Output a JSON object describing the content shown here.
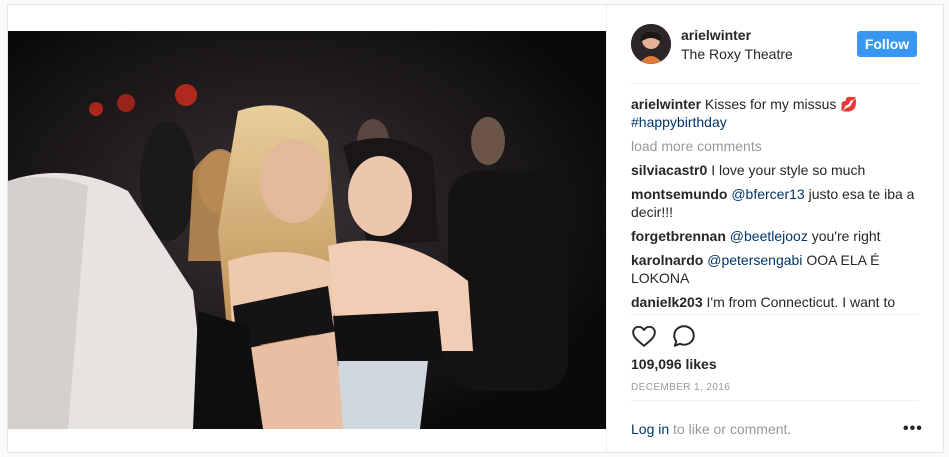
{
  "post": {
    "username": "arielwinter",
    "location": "The Roxy Theatre",
    "follow_label": "Follow",
    "caption_user": "arielwinter",
    "caption_text": "Kisses for my missus 💋",
    "caption_hashtag": "#happybirthday",
    "load_more": "load more comments",
    "comments": [
      {
        "user": "silviacastr0",
        "mention": "",
        "text": "I love your style so much"
      },
      {
        "user": "montsemundo",
        "mention": "@bfercer13",
        "text": "justo esa te iba a decir!!!"
      },
      {
        "user": "forgetbrennan",
        "mention": "@beetlejooz",
        "text": "you're right"
      },
      {
        "user": "karolnardo",
        "mention": "@petersengabi",
        "text": "OOA ELA É LOKONA"
      },
      {
        "user": "danielk203",
        "mention": "",
        "text": "I'm from Connecticut. I want to"
      }
    ],
    "likes": "109,096 likes",
    "date": "DECEMBER 1, 2016",
    "login_link": "Log in",
    "login_rest": "to like or comment.",
    "more_options": "•••"
  },
  "colors": {
    "follow_bg": "#3897f0",
    "link": "#003569",
    "muted": "#999999"
  },
  "icons": [
    "heart-icon",
    "comment-icon",
    "more-options-icon"
  ]
}
